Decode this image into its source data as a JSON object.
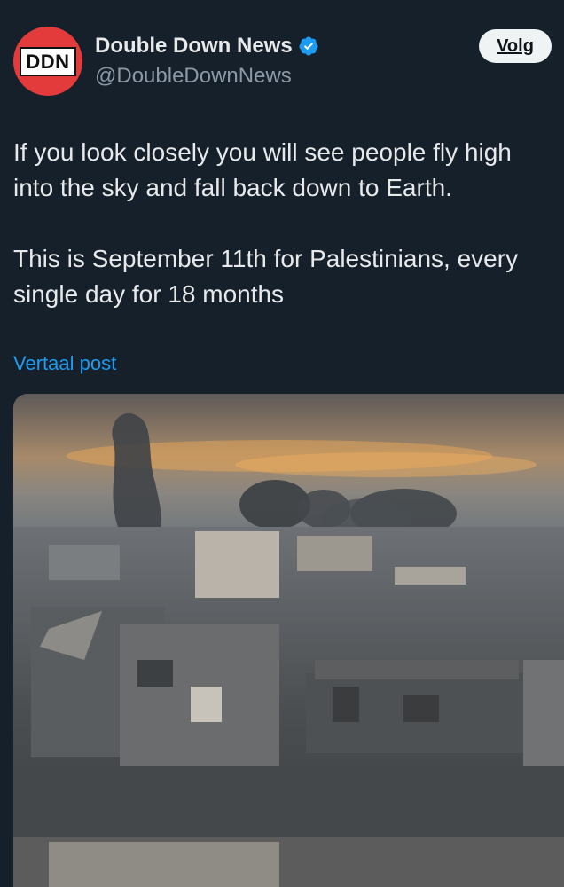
{
  "author": {
    "avatar_text": "DDN",
    "display_name": "Double Down News",
    "handle": "@DoubleDownNews",
    "verified": true
  },
  "follow_label": "Volg",
  "post": {
    "paragraph1": "If you look closely you will see people fly high into the sky and fall back down to Earth.",
    "paragraph2": "This is September 11th for Palestinians, every single day for 18 months"
  },
  "translate_label": "Vertaal post",
  "colors": {
    "background": "#15202b",
    "accent": "#1d9bf0",
    "verified": "#1d9bf0",
    "avatar": "#e33b3b"
  },
  "media": {
    "icon": "photo-icon"
  }
}
